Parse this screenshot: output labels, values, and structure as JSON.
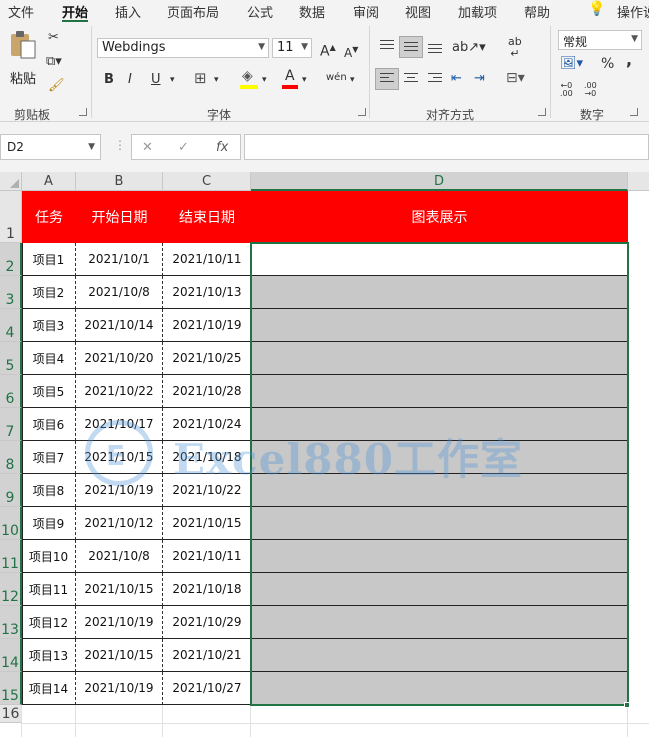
{
  "ribbon_tabs": [
    "文件",
    "开始",
    "插入",
    "页面布局",
    "公式",
    "数据",
    "审阅",
    "视图",
    "加载项",
    "帮助",
    "操作说"
  ],
  "active_tab": "开始",
  "clipboard": {
    "paste_label": "粘贴",
    "group_label": "剪贴板"
  },
  "font": {
    "name": "Webdings",
    "size": "11",
    "grow": "A",
    "shrink": "A",
    "bold": "B",
    "italic": "I",
    "underline": "U",
    "font_color": "A",
    "phonetic": "wén",
    "group_label": "字体"
  },
  "alignment": {
    "group_label": "对齐方式",
    "wrap_glyph": "ab"
  },
  "number": {
    "format": "常规",
    "percent": "%",
    "comma": ",",
    "group_label": "数字"
  },
  "name_box": "D2",
  "formula_value": "",
  "column_headers": [
    "A",
    "B",
    "C",
    "D"
  ],
  "selected_column": "D",
  "row_numbers": [
    "1",
    "2",
    "3",
    "4",
    "5",
    "6",
    "7",
    "8",
    "9",
    "10",
    "11",
    "12",
    "13",
    "14",
    "15",
    "16"
  ],
  "table": {
    "headers": [
      "任务",
      "开始日期",
      "结束日期",
      "图表展示"
    ],
    "rows": [
      [
        "项目1",
        "2021/10/1",
        "2021/10/11"
      ],
      [
        "项目2",
        "2021/10/8",
        "2021/10/13"
      ],
      [
        "项目3",
        "2021/10/14",
        "2021/10/19"
      ],
      [
        "项目4",
        "2021/10/20",
        "2021/10/25"
      ],
      [
        "项目5",
        "2021/10/22",
        "2021/10/28"
      ],
      [
        "项目6",
        "2021/10/17",
        "2021/10/24"
      ],
      [
        "项目7",
        "2021/10/15",
        "2021/10/18"
      ],
      [
        "项目8",
        "2021/10/19",
        "2021/10/22"
      ],
      [
        "项目9",
        "2021/10/12",
        "2021/10/15"
      ],
      [
        "项目10",
        "2021/10/8",
        "2021/10/11"
      ],
      [
        "项目11",
        "2021/10/15",
        "2021/10/18"
      ],
      [
        "项目12",
        "2021/10/19",
        "2021/10/29"
      ],
      [
        "项目13",
        "2021/10/15",
        "2021/10/21"
      ],
      [
        "项目14",
        "2021/10/19",
        "2021/10/27"
      ]
    ]
  },
  "watermark": {
    "logo_char": "E",
    "text": "Excel880工作室"
  },
  "colors": {
    "header_fill": "#ff0000",
    "selection": "#217346",
    "d_fill": "#c8c8c8"
  }
}
